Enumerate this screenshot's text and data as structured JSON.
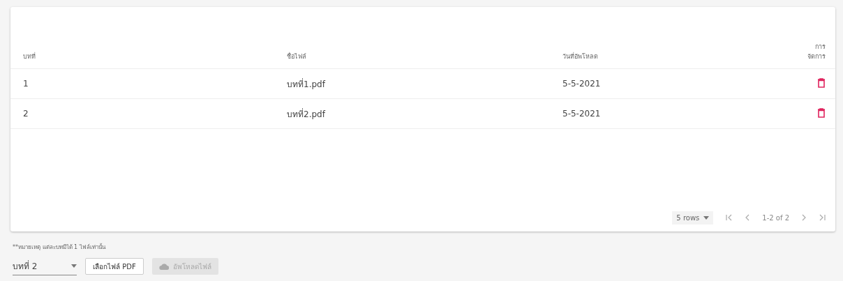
{
  "table": {
    "columns": [
      "บทที่",
      "ชื่อไฟล์",
      "วันที่อัพโหลด",
      "การจัดการ"
    ],
    "rows": [
      {
        "chapter": "1",
        "file": "บทที่1.pdf",
        "date": "5-5-2021"
      },
      {
        "chapter": "2",
        "file": "บทที่2.pdf",
        "date": "5-5-2021"
      }
    ],
    "pagination": {
      "rows_per_page": "5 rows",
      "range": "1-2 of 2"
    }
  },
  "note": "**หมายเหตุ แต่ละบทมีได้ 1 ไฟล์เท่านั้น",
  "chapter_select": {
    "value": "บทที่ 2"
  },
  "buttons": [
    {
      "label": "เลือกไฟล์ PDF",
      "kind": "outline",
      "disabled": false
    },
    {
      "label": "อัพโหลดไฟล์",
      "kind": "upload",
      "disabled": true
    }
  ]
}
